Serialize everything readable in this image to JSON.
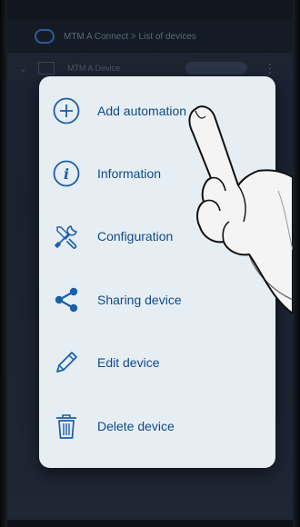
{
  "background": {
    "app_header_crumb": "MTM A Connect  >  List of devices",
    "device_row_name": "MTM A Device"
  },
  "menu": {
    "items": [
      {
        "label": "Add automation",
        "icon": "plus-circle-icon"
      },
      {
        "label": "Information",
        "icon": "info-icon"
      },
      {
        "label": "Configuration",
        "icon": "tools-icon"
      },
      {
        "label": "Sharing device",
        "icon": "share-icon"
      },
      {
        "label": "Edit device",
        "icon": "pencil-icon"
      },
      {
        "label": "Delete device",
        "icon": "trash-icon"
      }
    ]
  },
  "colors": {
    "menu_background": "#e6eef3",
    "menu_text": "#0f4a8a",
    "icon_color": "#1a5fa8"
  }
}
